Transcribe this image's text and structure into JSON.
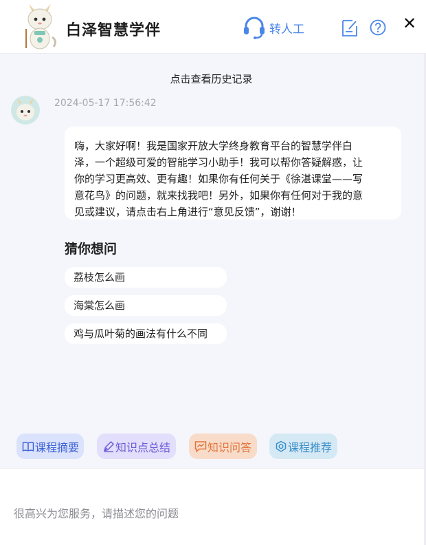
{
  "header": {
    "title": "白泽智慧学伴",
    "human_service_label": "转人工",
    "close_glyph": "✕"
  },
  "chat": {
    "history_link": "点击查看历史记录",
    "timestamp": "2024-05-17 17:56:42",
    "greeting_lines": [
      "嗨，大家好啊！我是国家开放大学终身教育平台的智慧学伴白",
      "泽，一个超级可爱的智能学习小助手！我可以帮你答疑解惑，让",
      "你的学习更高效、更有趣！如果你有任何关于《徐湛课堂——写",
      "意花鸟》的问题，就来找我吧！另外，如果你有任何对于我的意",
      "见或建议，请点击右上角进行“意见反馈”，谢谢！"
    ]
  },
  "suggestions": {
    "title": "猜你想问",
    "items": [
      "荔枝怎么画",
      "海棠怎么画",
      "鸡与瓜叶菊的画法有什么不同"
    ]
  },
  "quick_actions": [
    {
      "label": "课程摘要",
      "icon": "book-icon",
      "color": "#3d63d6"
    },
    {
      "label": "知识点总结",
      "icon": "pen-icon",
      "color": "#6a5bd6"
    },
    {
      "label": "知识问答",
      "icon": "chat-icon",
      "color": "#e2733a"
    },
    {
      "label": "课程推荐",
      "icon": "badge-icon",
      "color": "#3a8ec9"
    }
  ],
  "input": {
    "placeholder": "很高兴为您服务，请描述您的问题"
  },
  "colors": {
    "accent": "#4a86e8",
    "background": "#f5f6fc"
  }
}
